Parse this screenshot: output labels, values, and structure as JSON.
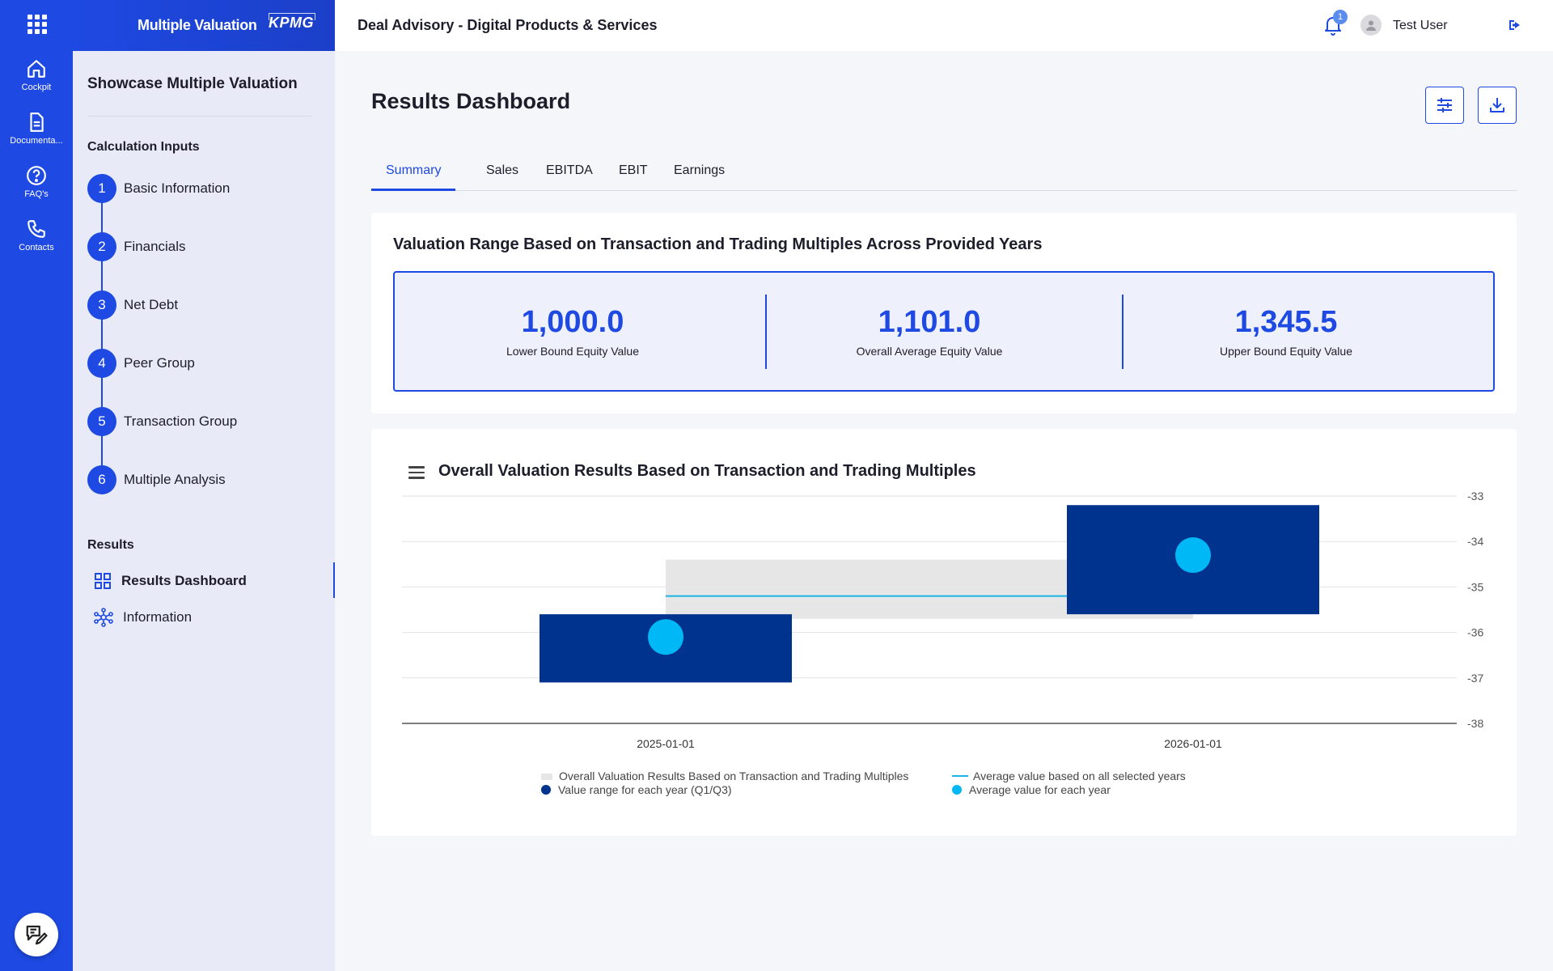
{
  "rail": {
    "items": [
      {
        "label": "Cockpit",
        "icon": "home-icon"
      },
      {
        "label": "Documenta...",
        "icon": "document-icon"
      },
      {
        "label": "FAQ's",
        "icon": "help-icon"
      },
      {
        "label": "Contacts",
        "icon": "phone-icon"
      }
    ]
  },
  "app": {
    "title": "Multiple Valuation",
    "logo": "KPMG"
  },
  "sidebar": {
    "title": "Showcase Multiple Valuation",
    "inputs_heading": "Calculation Inputs",
    "steps": [
      {
        "num": "1",
        "label": "Basic Information"
      },
      {
        "num": "2",
        "label": "Financials"
      },
      {
        "num": "3",
        "label": "Net Debt"
      },
      {
        "num": "4",
        "label": "Peer Group"
      },
      {
        "num": "5",
        "label": "Transaction Group"
      },
      {
        "num": "6",
        "label": "Multiple Analysis"
      }
    ],
    "results_heading": "Results",
    "results_items": [
      {
        "label": "Results Dashboard",
        "icon": "grid-icon",
        "active": true
      },
      {
        "label": "Information",
        "icon": "network-icon",
        "active": false
      }
    ]
  },
  "header": {
    "title": "Deal Advisory - Digital Products & Services",
    "notifications": "1",
    "user": "Test User"
  },
  "main": {
    "title": "Results Dashboard",
    "tabs": [
      {
        "label": "Summary",
        "active": true
      },
      {
        "label": "Sales"
      },
      {
        "label": "EBITDA"
      },
      {
        "label": "EBIT"
      },
      {
        "label": "Earnings"
      }
    ],
    "range_card": {
      "title": "Valuation Range Based on Transaction and Trading Multiples Across Provided Years",
      "kpis": [
        {
          "value": "1,000.0",
          "label": "Lower Bound Equity Value"
        },
        {
          "value": "1,101.0",
          "label": "Overall Average Equity Value"
        },
        {
          "value": "1,345.5",
          "label": "Upper Bound Equity Value"
        }
      ]
    }
  },
  "colors": {
    "accent": "#1e49e2",
    "dark_bar": "#00338d",
    "light_bar": "#e6e6e6",
    "dot": "#00b8f5",
    "avg_line": "#1ab5e8"
  },
  "chart_data": {
    "type": "bar",
    "title": "Overall Valuation Results Based on Transaction and Trading Multiples",
    "categories": [
      "2025-01-01",
      "2026-01-01"
    ],
    "ylim": [
      -38,
      -33
    ],
    "yticks": [
      "-33",
      "-34",
      "-35",
      "-36",
      "-37",
      "-38"
    ],
    "grid": true,
    "legend_position": "bottom",
    "overall_range": {
      "low": -35.7,
      "high": -34.4
    },
    "average_all_years": -35.2,
    "series": [
      {
        "name": "Value range for each year (Q1/Q3)",
        "low": [
          -37.1,
          -35.6
        ],
        "high": [
          -35.6,
          -33.2
        ]
      },
      {
        "name": "Average value for each year",
        "values": [
          -36.1,
          -34.3
        ]
      }
    ],
    "legend": [
      "Overall Valuation Results Based on Transaction and Trading Multiples",
      "Value range for each year (Q1/Q3)",
      "Average value based on all selected years",
      "Average value for each year"
    ]
  }
}
